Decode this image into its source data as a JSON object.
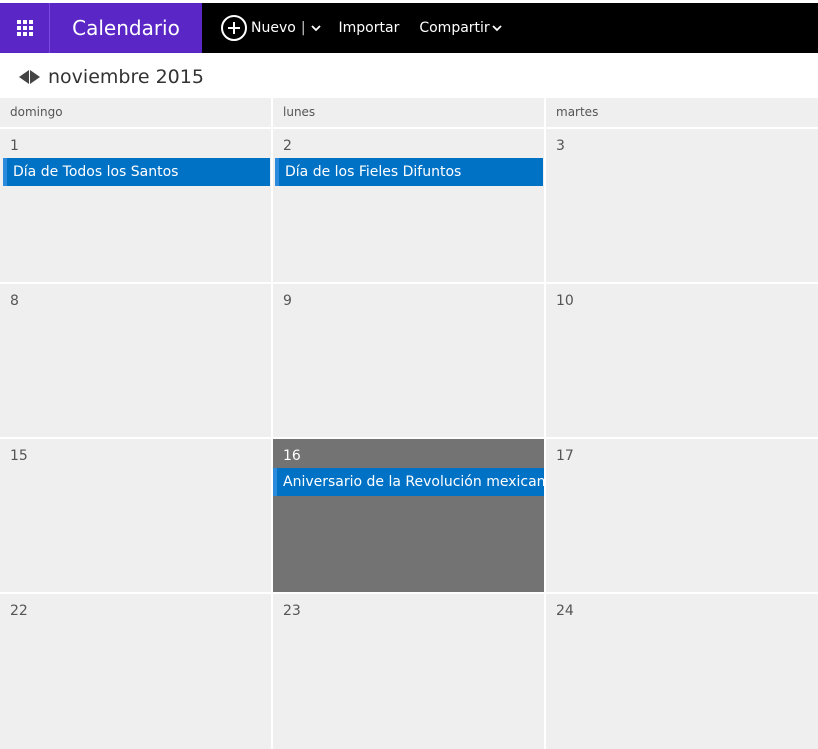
{
  "topbar": {
    "app_name": "Calendario",
    "new_label": "Nuevo",
    "new_separator": "|",
    "import_label": "Importar",
    "share_label": "Compartir",
    "brand_color": "#5a27c6"
  },
  "nav": {
    "month_label": "noviembre 2015"
  },
  "calendar": {
    "day_headers": [
      "domingo",
      "lunes",
      "martes"
    ],
    "weeks": [
      {
        "days": [
          {
            "number": "1",
            "event": "Día de Todos los Santos"
          },
          {
            "number": "2",
            "event": "Día de los Fieles Difuntos"
          },
          {
            "number": "3"
          }
        ]
      },
      {
        "days": [
          {
            "number": "8"
          },
          {
            "number": "9"
          },
          {
            "number": "10"
          }
        ]
      },
      {
        "days": [
          {
            "number": "15"
          },
          {
            "number": "16",
            "today": true,
            "event": "Aniversario de la Revolución mexicana"
          },
          {
            "number": "17"
          }
        ]
      },
      {
        "days": [
          {
            "number": "22"
          },
          {
            "number": "23"
          },
          {
            "number": "24"
          }
        ]
      }
    ],
    "event_color": "#0072c6",
    "today_color": "#737373"
  }
}
